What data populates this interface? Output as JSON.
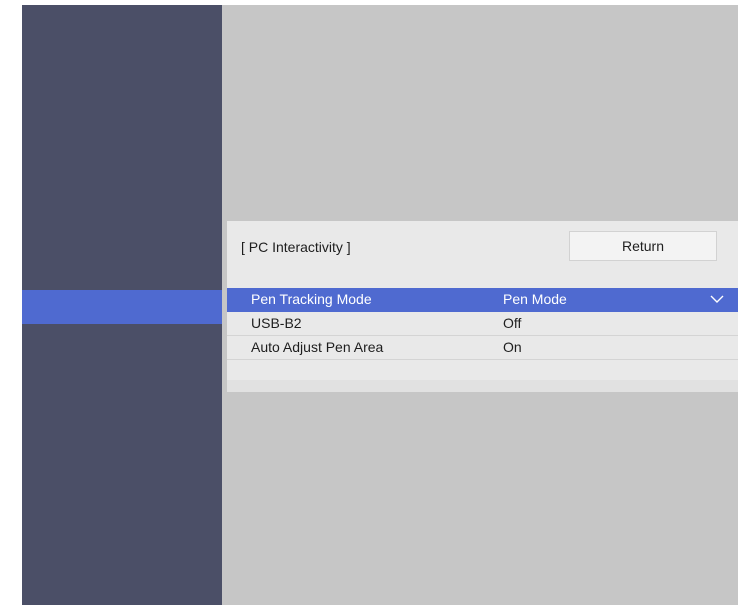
{
  "panel": {
    "title": "[ PC Interactivity ]",
    "return_label": "Return"
  },
  "settings": [
    {
      "label": "Pen Tracking Mode",
      "value": "Pen Mode",
      "selected": true,
      "has_dropdown": true
    },
    {
      "label": "USB-B2",
      "value": "Off",
      "selected": false,
      "has_dropdown": false
    },
    {
      "label": "Auto Adjust Pen Area",
      "value": "On",
      "selected": false,
      "has_dropdown": false
    }
  ],
  "icons": {
    "dropdown": "chevron-down-icon"
  },
  "colors": {
    "sidebar": "#4b4f67",
    "highlight": "#4f6ad0",
    "background": "#c6c6c6",
    "panel": "#e9e9e9"
  }
}
